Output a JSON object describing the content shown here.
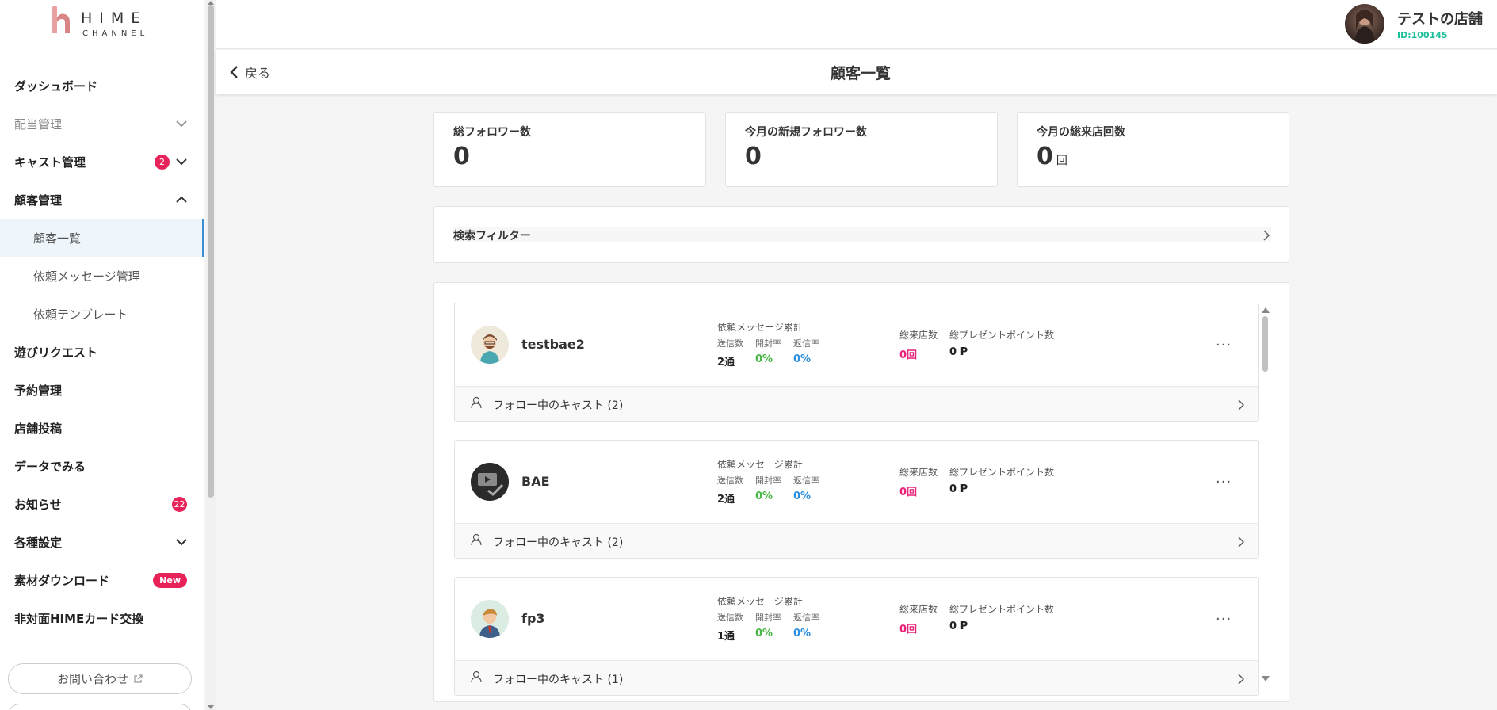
{
  "app": {
    "logo_word": "HIME",
    "logo_sub": "CHANNEL"
  },
  "sidebar": {
    "items": [
      {
        "label": "ダッシュボード"
      },
      {
        "label": "配当管理"
      },
      {
        "label": "キャスト管理",
        "badge": "2"
      },
      {
        "label": "顧客管理"
      },
      {
        "label": "顧客一覧"
      },
      {
        "label": "依頼メッセージ管理"
      },
      {
        "label": "依頼テンプレート"
      },
      {
        "label": "遊びリクエスト"
      },
      {
        "label": "予約管理"
      },
      {
        "label": "店舗投稿"
      },
      {
        "label": "データでみる"
      },
      {
        "label": "お知らせ",
        "badge": "22"
      },
      {
        "label": "各種設定"
      },
      {
        "label": "素材ダウンロード",
        "badge": "New"
      },
      {
        "label": "非対面HIMEカード交換"
      }
    ],
    "contact_label": "お問い合わせ"
  },
  "header": {
    "store_name": "テストの店舗",
    "store_id": "ID:100145",
    "back_label": "戻る",
    "page_title": "顧客一覧"
  },
  "stats": [
    {
      "label": "総フォロワー数",
      "value": "0",
      "unit": ""
    },
    {
      "label": "今月の新規フォロワー数",
      "value": "0",
      "unit": ""
    },
    {
      "label": "今月の総来店回数",
      "value": "0",
      "unit": "回"
    }
  ],
  "filter": {
    "label": "検索フィルター"
  },
  "labels": {
    "msg_title": "依頼メッセージ累計",
    "sent": "送信数",
    "open_rate": "開封率",
    "reply_rate": "返信率",
    "visits": "総来店数",
    "points": "総プレゼントポイント数",
    "more": "···"
  },
  "customers": [
    {
      "name": "testbae2",
      "sent": "2通",
      "open_rate": "0%",
      "reply_rate": "0%",
      "visits": "0回",
      "points": "0 P",
      "follow_label": "フォロー中のキャスト (2)"
    },
    {
      "name": "BAE",
      "sent": "2通",
      "open_rate": "0%",
      "reply_rate": "0%",
      "visits": "0回",
      "points": "0 P",
      "follow_label": "フォロー中のキャスト (2)"
    },
    {
      "name": "fp3",
      "sent": "1通",
      "open_rate": "0%",
      "reply_rate": "0%",
      "visits": "0回",
      "points": "0 P",
      "follow_label": "フォロー中のキャスト (1)"
    }
  ],
  "colors": {
    "accent_pink": "#e8237a",
    "badge_red": "#e8235a",
    "green": "#49b847",
    "blue": "#2d8fe0",
    "id_teal": "#1bbf9a"
  }
}
